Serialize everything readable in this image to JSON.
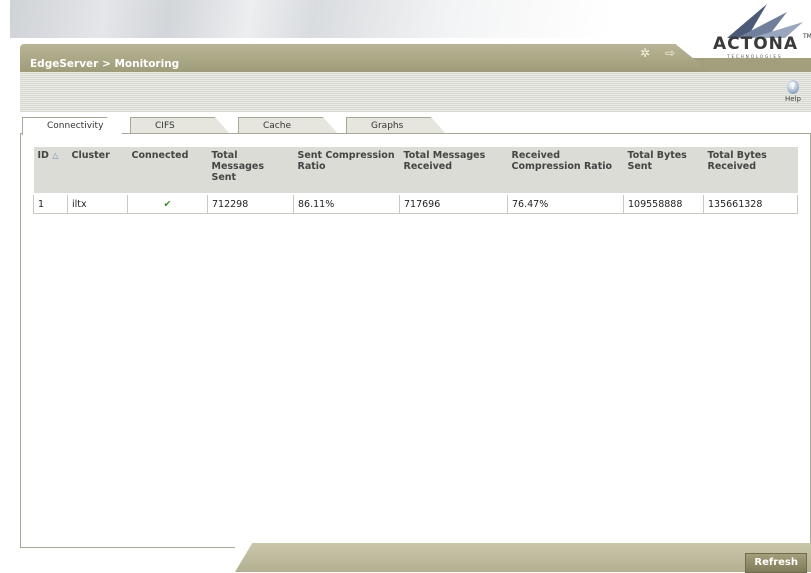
{
  "header": {
    "breadcrumb": "EdgeServer > Monitoring",
    "logo": "ACTONA",
    "logo_sub": "TECHNOLOGIES",
    "logo_tm": "TM",
    "icons": [
      "wizard-icon",
      "logout-icon"
    ],
    "help_label": "Help"
  },
  "tabs": [
    {
      "label": "Connectivity",
      "active": true
    },
    {
      "label": "CIFS",
      "active": false
    },
    {
      "label": "Cache",
      "active": false
    },
    {
      "label": "Graphs",
      "active": false
    }
  ],
  "table": {
    "columns": [
      "ID",
      "Cluster",
      "Connected",
      "Total Messages Sent",
      "Sent Compression Ratio",
      "Total Messages Received",
      "Received Compression Ratio",
      "Total Bytes Sent",
      "Total Bytes Received"
    ],
    "sort_indicator": "△",
    "rows": [
      [
        "1",
        "iltx",
        "✔",
        "712298",
        "86.11%",
        "717696",
        "76.47%",
        "109558888",
        "135661328"
      ]
    ]
  },
  "footer": {
    "refresh_label": "Refresh"
  },
  "colors": {
    "olive": "#a29f7c",
    "accent_check": "#3d8a2e"
  }
}
